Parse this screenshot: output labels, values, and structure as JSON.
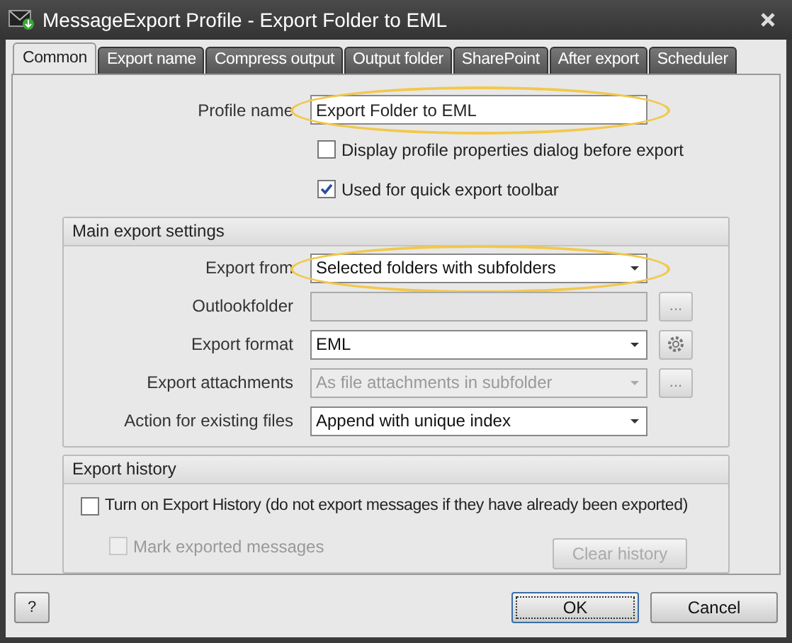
{
  "window": {
    "title": "MessageExport Profile - Export Folder to EML"
  },
  "tabs": [
    {
      "label": "Common",
      "selected": true
    },
    {
      "label": "Export name",
      "selected": false
    },
    {
      "label": "Compress output",
      "selected": false
    },
    {
      "label": "Output folder",
      "selected": false
    },
    {
      "label": "SharePoint",
      "selected": false
    },
    {
      "label": "After export",
      "selected": false
    },
    {
      "label": "Scheduler",
      "selected": false
    }
  ],
  "profile_name": {
    "label": "Profile name",
    "value": "Export Folder to EML",
    "highlighted": true
  },
  "options": [
    {
      "label": "Display profile properties dialog before export",
      "checked": false
    },
    {
      "label": "Used for quick export toolbar",
      "checked": true
    }
  ],
  "main_settings": {
    "title": "Main export settings",
    "rows": [
      {
        "label": "Export from",
        "kind": "dropdown",
        "value": "Selected folders with subfolders",
        "disabled": false,
        "highlighted": true
      },
      {
        "label": "Outlookfolder",
        "kind": "text",
        "disabled": true,
        "side": {
          "kind": "text",
          "label": "..."
        }
      },
      {
        "label": "Export format",
        "kind": "dropdown",
        "value": "EML",
        "disabled": false,
        "side": {
          "kind": "gear"
        }
      },
      {
        "label": "Export attachments",
        "kind": "dropdown",
        "value": "As file attachments in subfolder",
        "disabled": true,
        "side": {
          "kind": "text",
          "label": "..."
        }
      },
      {
        "label": "Action for existing files",
        "kind": "dropdown",
        "value": "Append with unique index",
        "disabled": false
      }
    ]
  },
  "export_history": {
    "title": "Export history",
    "options": [
      {
        "label": "Turn on Export History (do not export messages if they have already been exported)",
        "checked": false,
        "disabled": false
      },
      {
        "label": "Mark exported messages",
        "checked": false,
        "disabled": true
      }
    ],
    "clear_button": {
      "label": "Clear history",
      "disabled": true
    }
  },
  "footer": {
    "help": "?",
    "buttons": [
      {
        "label": "OK",
        "default": true
      },
      {
        "label": "Cancel",
        "default": false
      }
    ]
  }
}
